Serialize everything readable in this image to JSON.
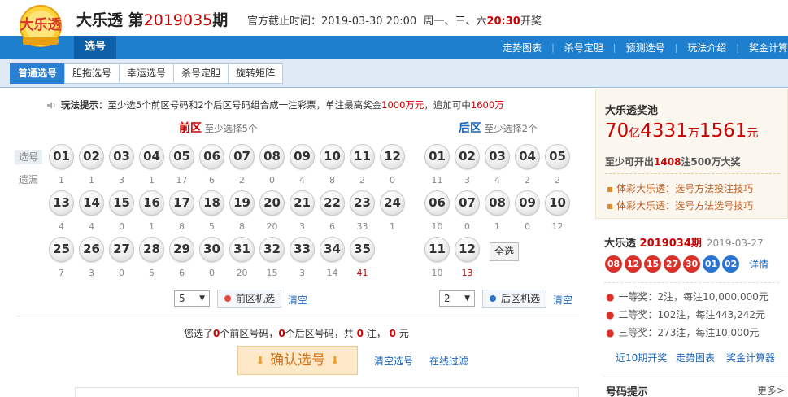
{
  "header": {
    "logo_text": "大乐透",
    "game_name": "大乐透",
    "issue_prefix": "第",
    "issue_number": "2019035",
    "issue_suffix": "期",
    "deadline_label": "官方截止时间：",
    "deadline_datetime": "2019-03-30 20:00",
    "draw_days": "周一、三、六",
    "draw_time": "20:30",
    "draw_suffix": "开奖"
  },
  "nav": {
    "current": "选号",
    "links": [
      "走势图表",
      "杀号定胆",
      "预测选号",
      "玩法介绍",
      "奖金计算"
    ]
  },
  "tabs": [
    "普通选号",
    "胆拖选号",
    "幸运选号",
    "杀号定胆",
    "旋转矩阵"
  ],
  "tip": {
    "label": "玩法提示：",
    "text_1": "至少选5个前区号码和2个后区号码组合成一注彩票，单注最高奖金",
    "amount_1": "1000万元",
    "text_2": "，追加可中",
    "amount_2": "1600万"
  },
  "front": {
    "title": "前区",
    "hint": "至少选择5个",
    "numbers": [
      "01",
      "02",
      "03",
      "04",
      "05",
      "06",
      "07",
      "08",
      "09",
      "10",
      "11",
      "12",
      "13",
      "14",
      "15",
      "16",
      "17",
      "18",
      "19",
      "20",
      "21",
      "22",
      "23",
      "24",
      "25",
      "26",
      "27",
      "28",
      "29",
      "30",
      "31",
      "32",
      "33",
      "34",
      "35"
    ],
    "missing": [
      "1",
      "1",
      "3",
      "1",
      "17",
      "6",
      "2",
      "0",
      "4",
      "8",
      "2",
      "0",
      "4",
      "4",
      "0",
      "1",
      "8",
      "5",
      "8",
      "20",
      "3",
      "6",
      "33",
      "1",
      "7",
      "3",
      "0",
      "5",
      "6",
      "0",
      "20",
      "15",
      "3",
      "14",
      "41"
    ],
    "random_count": "5",
    "random_label": "前区机选",
    "clear_label": "清空"
  },
  "back": {
    "title": "后区",
    "hint": "至少选择2个",
    "numbers": [
      "01",
      "02",
      "03",
      "04",
      "05",
      "06",
      "07",
      "08",
      "09",
      "10",
      "11",
      "12"
    ],
    "missing": [
      "11",
      "3",
      "4",
      "2",
      "2",
      "10",
      "0",
      "1",
      "0",
      "12",
      "10",
      "13"
    ],
    "all_label": "全选",
    "random_count": "2",
    "random_label": "后区机选",
    "clear_label": "清空"
  },
  "row_labels": {
    "select": "选号",
    "missing": "遗漏"
  },
  "summary": {
    "t1": "您选了",
    "front_count": "0",
    "t2": "个前区号码，",
    "back_count": "0",
    "t3": "个后区号码，共",
    "bets": "0",
    "t4": "注，",
    "amount": "0",
    "t5": "元"
  },
  "actions": {
    "confirm": "确认选号",
    "clear": "清空选号",
    "filter": "在线过滤"
  },
  "pool": {
    "title": "大乐透奖池",
    "yi": "70",
    "yi_unit": "亿",
    "wan": "4331",
    "wan_unit": "万",
    "yuan": "1561",
    "yuan_unit": "元",
    "note_1": "至少可开出",
    "note_count": "1408",
    "note_2": "注500万大奖",
    "links": [
      "体彩大乐透：选号方法投注技巧",
      "体彩大乐透：选号方法选号技巧"
    ]
  },
  "last_draw": {
    "game": "大乐透",
    "issue": "2019034期",
    "date": "2019-03-27",
    "red": [
      "08",
      "12",
      "15",
      "27",
      "30"
    ],
    "blue": [
      "01",
      "02"
    ],
    "detail": "详情",
    "prizes": [
      {
        "name": "一等奖：",
        "count": "2注，",
        "each": "每注10,000,000元"
      },
      {
        "name": "二等奖：",
        "count": "102注，",
        "each": "每注443,242元"
      },
      {
        "name": "三等奖：",
        "count": "273注，",
        "each": "每注10,000元"
      }
    ],
    "quick_links": [
      "近10期开奖",
      "走势图表",
      "奖金计算器"
    ]
  },
  "hint_section": {
    "title": "号码提示",
    "more": "更多>"
  },
  "colors": {
    "nav_blue": "#1f7fcf",
    "red": "#d7312a",
    "blue": "#2a74d0",
    "confirm_bg": "#fde9c8"
  }
}
